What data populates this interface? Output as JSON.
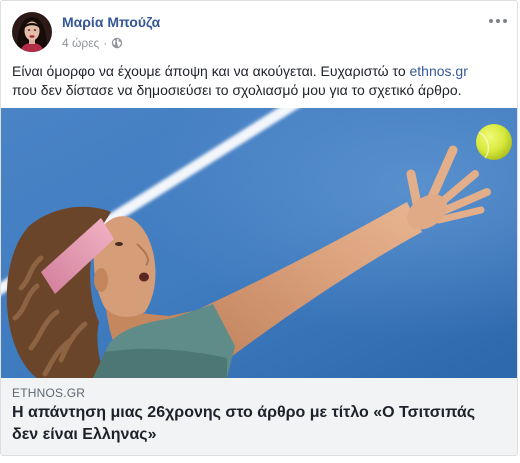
{
  "post": {
    "author": "Μαρία Μπούζα",
    "time": "4 ώρες",
    "separator": "·",
    "text_part1": "Είναι όμορφο να έχουμε άποψη και να ακούγεται. Ευχαριστώ το ",
    "text_link": "ethnos.gr",
    "text_part2": "που δεν δίστασε να δημοσιεύσει το σχολιασμό μου για το σχετικό άρθρο."
  },
  "icons": {
    "privacy": "globe-icon",
    "more": "more-options-icon"
  },
  "link_preview": {
    "domain": "ETHNOS.GR",
    "title_lines": [
      "Η απάντηση μιας 26χρονης στο άρθρο με τίτλο «Ο Τσιτσιπάς",
      "δεν είναι Ελληνας»"
    ]
  },
  "colors": {
    "link": "#365899",
    "text": "#1d2129",
    "meta": "#90949c",
    "preview_bg": "#f2f3f5"
  }
}
